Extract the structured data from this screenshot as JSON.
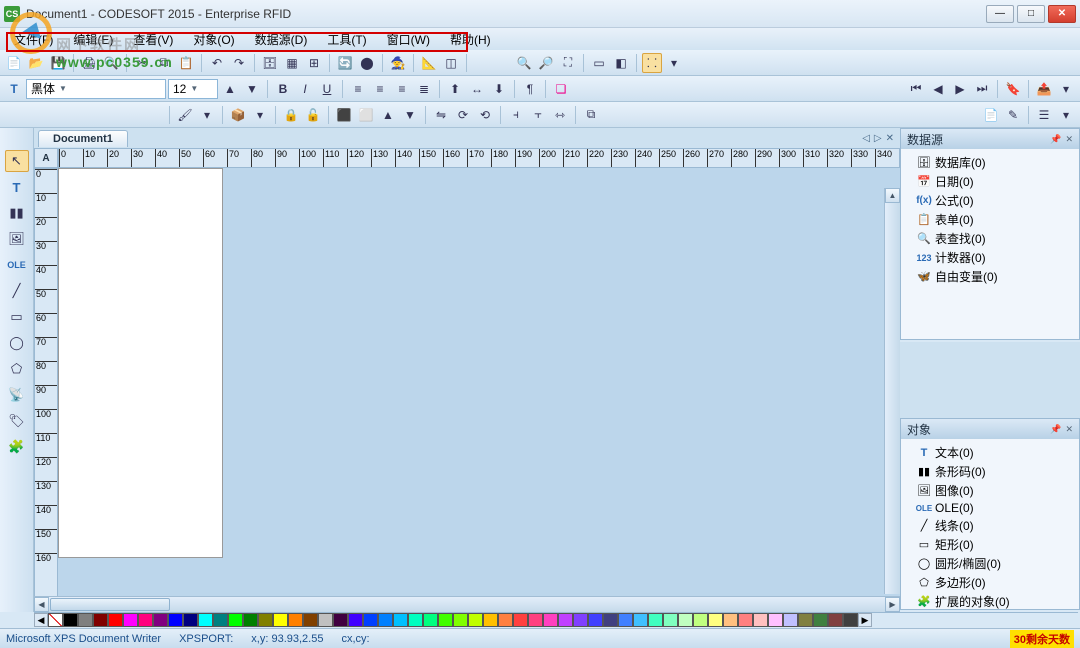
{
  "title": "Document1 - CODESOFT 2015 - Enterprise RFID",
  "appicon_text": "CS",
  "watermark_url": "www.pc0359.cn",
  "watermark_cn": "网下软件网",
  "menu": [
    "文件(F)",
    "编辑(E)",
    "查看(V)",
    "对象(O)",
    "数据源(D)",
    "工具(T)",
    "窗口(W)",
    "帮助(H)"
  ],
  "font": {
    "name": "黑体",
    "size": "12"
  },
  "doc_tab": "Document1",
  "ruler_unit": "A",
  "hruler": [
    0,
    10,
    20,
    30,
    40,
    50,
    60,
    70,
    80,
    90,
    100,
    110,
    120,
    130,
    140,
    150,
    160,
    170,
    180,
    190,
    200,
    210,
    220,
    230,
    240,
    250,
    260,
    270,
    280,
    290,
    300,
    310,
    320,
    330,
    340
  ],
  "vruler": [
    0,
    10,
    20,
    30,
    40,
    50,
    60,
    70,
    80,
    90,
    100,
    110,
    120,
    130,
    140,
    150,
    160
  ],
  "panels": {
    "datasource": {
      "title": "数据源",
      "items": [
        {
          "icon": "db",
          "label": "数据库(0)"
        },
        {
          "icon": "date",
          "label": "日期(0)"
        },
        {
          "icon": "fx",
          "label": "公式(0)"
        },
        {
          "icon": "form",
          "label": "表单(0)"
        },
        {
          "icon": "lookup",
          "label": "表查找(0)"
        },
        {
          "icon": "counter",
          "label": "计数器(0)"
        },
        {
          "icon": "free",
          "label": "自由变量(0)"
        }
      ]
    },
    "objects": {
      "title": "对象",
      "items": [
        {
          "icon": "text",
          "label": "文本(0)"
        },
        {
          "icon": "barcode",
          "label": "条形码(0)"
        },
        {
          "icon": "image",
          "label": "图像(0)"
        },
        {
          "icon": "ole",
          "label": "OLE(0)"
        },
        {
          "icon": "line",
          "label": "线条(0)"
        },
        {
          "icon": "rect",
          "label": "矩形(0)"
        },
        {
          "icon": "ellipse",
          "label": "圆形/椭圆(0)"
        },
        {
          "icon": "polygon",
          "label": "多边形(0)"
        },
        {
          "icon": "extended",
          "label": "扩展的对象(0)"
        }
      ]
    }
  },
  "colors": [
    "#000000",
    "#7f7f7f",
    "#800000",
    "#ff0000",
    "#ff00ff",
    "#ff007f",
    "#800080",
    "#0000ff",
    "#000080",
    "#00ffff",
    "#008080",
    "#00ff00",
    "#008000",
    "#808000",
    "#ffff00",
    "#ff8000",
    "#804000",
    "#c0c0c0",
    "#400040",
    "#4000ff",
    "#0040ff",
    "#0080ff",
    "#00c0ff",
    "#00ffc0",
    "#00ff80",
    "#40ff00",
    "#80ff00",
    "#c0ff00",
    "#ffc000",
    "#ff8040",
    "#ff4040",
    "#ff4080",
    "#ff40c0",
    "#c040ff",
    "#8040ff",
    "#4040ff",
    "#404080",
    "#4080ff",
    "#40c0ff",
    "#40ffc0",
    "#80ffc0",
    "#c0ffc0",
    "#c0ff80",
    "#ffff80",
    "#ffc080",
    "#ff8080",
    "#ffc0c0",
    "#ffc0ff",
    "#c0c0ff",
    "#808040",
    "#408040",
    "#804040",
    "#404040"
  ],
  "status": {
    "printer": "Microsoft XPS Document Writer",
    "port": "XPSPORT:",
    "xy_label": "x,y:",
    "xy": "93.93,2.55",
    "cxcy_label": "cx,cy:",
    "cxcy": "",
    "trial": "30剩余天数"
  }
}
